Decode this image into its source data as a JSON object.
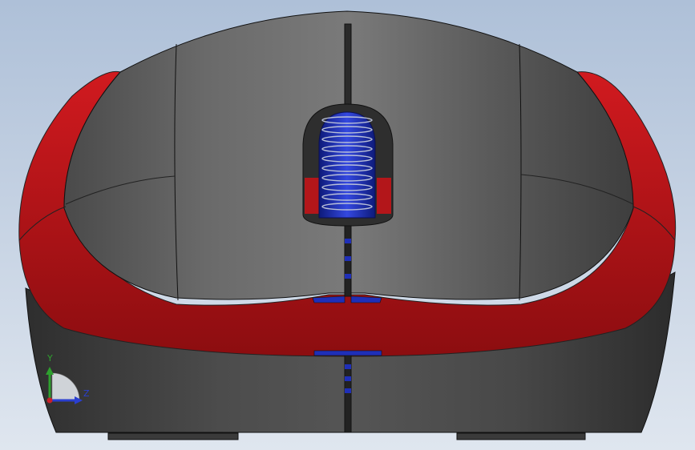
{
  "viewport": {
    "background_top": "#aec0d8",
    "background_bottom": "#dfe6ef"
  },
  "model": {
    "body_color": "#5b5b5b",
    "body_dark": "#3c3c3c",
    "accent_color": "#c0161b",
    "wheel_color": "#1f2fb8"
  },
  "triad": {
    "y_label": "Y",
    "z_label": "Z",
    "y_color": "#2ea02e",
    "z_color": "#2a3fd0",
    "x_color": "#c8202a"
  }
}
